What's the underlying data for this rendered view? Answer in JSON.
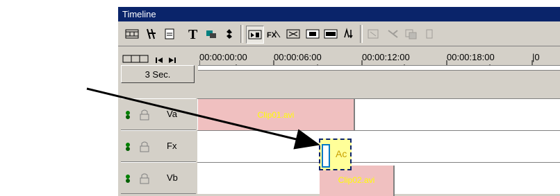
{
  "window": {
    "title": "Timeline"
  },
  "toolbar": {
    "icons": [
      "storyboard-icon",
      "split-icon",
      "page-icon",
      "title-text-icon",
      "overlay-icon",
      "audio-icon",
      "select-tool-icon",
      "fx-tool-icon",
      "zoom-tool-icon",
      "insert-icon",
      "overwrite-icon",
      "sync-icon",
      "snap-icon",
      "preview-icon",
      "render-icon"
    ]
  },
  "ruler": {
    "timecodes": [
      "00:00:00:00",
      "00:00:06:00",
      "00:00:12:00",
      "00:00:18:00"
    ]
  },
  "scale": {
    "label": "3 Sec."
  },
  "tracks": [
    {
      "name": "Va"
    },
    {
      "name": "Fx"
    },
    {
      "name": "Vb"
    }
  ],
  "clips": {
    "clip1": "Clip01.avi",
    "clip2": "Clip02.avi",
    "transition": "Ac"
  },
  "colors": {
    "title_bar": "#0a246a",
    "clip_fill": "#f0c0c0",
    "clip_text": "#ffff00",
    "transition_fill": "#ffff99"
  }
}
